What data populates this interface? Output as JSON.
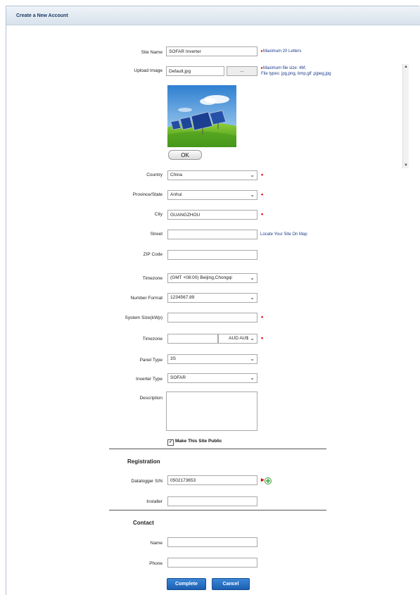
{
  "header": {
    "title": "Create a New Account"
  },
  "site_name": {
    "label": "Site Name",
    "value": "SOFAR Inverter",
    "hint": "Maximum 20 Letters"
  },
  "upload_image": {
    "label": "Upload Image",
    "value": "Default.jpg",
    "browse": "...",
    "hint_line1": "Maximum file size: 4M;",
    "hint_line2": "File types: jpg,png, bmp,gif ,pjpeg,jpg",
    "ok": "OK"
  },
  "country": {
    "label": "Country",
    "value": "China"
  },
  "province": {
    "label": "Province/State",
    "value": "Anhui"
  },
  "city": {
    "label": "City",
    "value": "GUANGZHOU"
  },
  "street": {
    "label": "Street",
    "value": "",
    "link": "Locate Your Site On Map"
  },
  "zip": {
    "label": "ZIP Code",
    "value": ""
  },
  "timezone": {
    "label": "Timezone",
    "value": "(GMT +08:00) Beijing,Chongqi"
  },
  "number_format": {
    "label": "Number Format",
    "value": "1234567.89"
  },
  "system_size": {
    "label": "System Size(kWp)",
    "value": ""
  },
  "currency": {
    "label": "Timezone",
    "value": "",
    "unit": "AUD AU$"
  },
  "panel_type": {
    "label": "Panel Type",
    "value": "3S"
  },
  "inverter_type": {
    "label": "Inverter Type",
    "value": "SOFAR"
  },
  "description": {
    "label": "Description",
    "value": ""
  },
  "public": {
    "label": "Make This Site Public",
    "checked": true
  },
  "registration": {
    "title": "Registration",
    "datalogger_label": "Datalogger S/N",
    "datalogger_value": "0502173653",
    "installer_label": "Installer",
    "installer_value": ""
  },
  "contact": {
    "title": "Contact",
    "name_label": "Name",
    "name_value": "",
    "phone_label": "Phone",
    "phone_value": ""
  },
  "actions": {
    "complete": "Complete",
    "cancel": "Cancel"
  },
  "colors": {
    "accent": "#1c5fb0",
    "required": "#e00000",
    "link": "#1d3b8a"
  },
  "icons": {
    "required": "required-marker-icon",
    "add": "add-circle-icon",
    "dropdown": "chevron-down-icon"
  }
}
